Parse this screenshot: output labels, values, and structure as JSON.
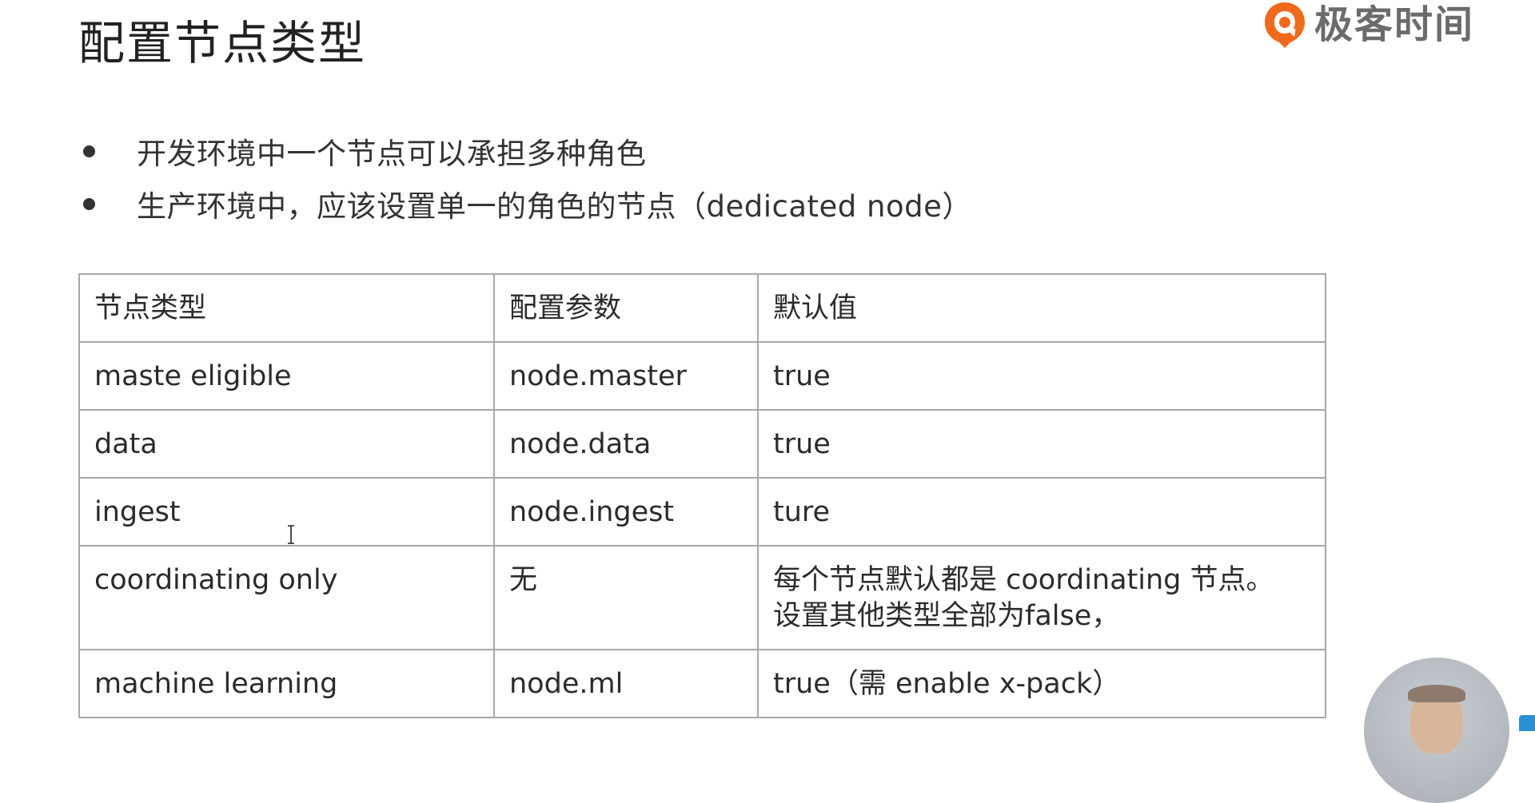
{
  "slide": {
    "title": "配置节点类型"
  },
  "logo": {
    "text": "极客时间",
    "icon": "geektime-logo-icon",
    "accent_color": "#f06a1d"
  },
  "bullets": [
    "开发环境中一个节点可以承担多种角色",
    "生产环境中，应该设置单一的角色的节点（dedicated node）"
  ],
  "table": {
    "headers": [
      "节点类型",
      "配置参数",
      "默认值"
    ],
    "rows": [
      {
        "type": "maste eligible",
        "param": "node.master",
        "default": [
          "true"
        ]
      },
      {
        "type": "data",
        "param": "node.data",
        "default": [
          "true"
        ]
      },
      {
        "type": "ingest",
        "param": "node.ingest",
        "default": [
          "ture"
        ]
      },
      {
        "type": "coordinating only",
        "param": "无",
        "default": [
          "每个节点默认都是 coordinating 节点。",
          "设置其他类型全部为false，"
        ]
      },
      {
        "type": "machine learning",
        "param": "node.ml",
        "default": [
          "true（需 enable x-pack）"
        ]
      }
    ]
  },
  "icons": {
    "cursor": "text-cursor-icon",
    "webcam": "presenter-webcam",
    "corner": "app-corner-icon"
  }
}
